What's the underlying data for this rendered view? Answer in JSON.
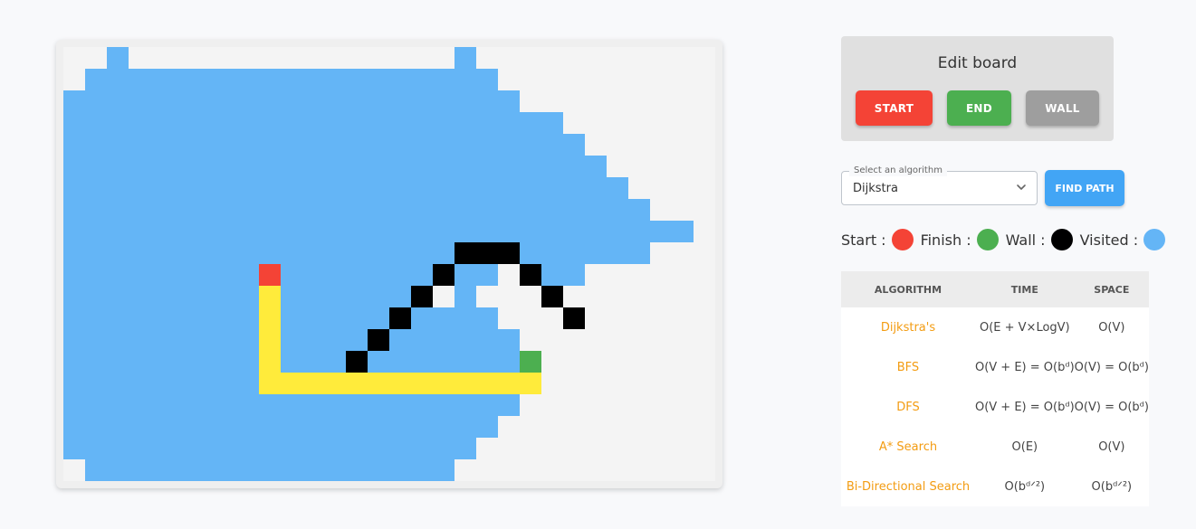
{
  "board": {
    "cols": 30,
    "rows": 20,
    "colors": {
      "empty": "#f4f4f4",
      "visited": "#64b5f6",
      "wall": "#000000",
      "path": "#ffeb3b",
      "start": "#f44336",
      "end": "#4caf50"
    },
    "cells": [
      "..V...............V...........",
      ".VVVVVVVVVVVVVVVVVVV..........",
      "VVVVVVVVVVVVVVVVVVVVV.........",
      "VVVVVVVVVVVVVVVVVVVVVVV.......",
      "VVVVVVVVVVVVVVVVVVVVVVVV......",
      "VVVVVVVVVVVVVVVVVVVVVVVVV.....",
      "VVVVVVVVVVVVVVVVVVVVVVVVVV....",
      "VVVVVVVVVVVVVVVVVVVVVVVVVVV...",
      "VVVVVVVVVVVVVVVVVVVVVVVVVVVVV.",
      "VVVVVVVVVVVVVVVVVVWWWVVVVVV...",
      "VVVVVVVVVSVVVVVVVWVV.WVV......",
      "VVVVVVVVVPVVVVVVW.V...W.......",
      "VVVVVVVVVPVVVVVWVVVV...W......",
      "VVVVVVVVVPVVVVWVVVVVV.........",
      "VVVVVVVVVPVVVWVVVVVVVE........",
      "VVVVVVVVVPPPPPPPPPPPPP........",
      "VVVVVVVVVVVVVVVVVVVVV.........",
      "VVVVVVVVVVVVVVVVVVVV..........",
      "VVVVVVVVVVVVVVVVVVV...........",
      ".VVVVVVVVVVVVVVVVV............"
    ]
  },
  "edit_board": {
    "title": "Edit board",
    "start_label": "START",
    "end_label": "END",
    "wall_label": "WALL"
  },
  "algorithm_select": {
    "label": "Select an algorithm",
    "value": "Dijkstra"
  },
  "find_path_label": "FIND PATH",
  "legend": {
    "start_label": "Start :",
    "finish_label": "Finish :",
    "wall_label": "Wall :",
    "visited_label": "Visited :",
    "start_color": "#f44336",
    "finish_color": "#4caf50",
    "wall_color": "#000000",
    "visited_color": "#64b5f6"
  },
  "table": {
    "headers": [
      "ALGORITHM",
      "TIME",
      "SPACE"
    ],
    "rows": [
      {
        "algorithm": "Dijkstra's",
        "time": "O(E + V×LogV)",
        "space": "O(V)"
      },
      {
        "algorithm": "BFS",
        "time": "O(V + E) = O(bᵈ)",
        "space": "O(V) = O(bᵈ)"
      },
      {
        "algorithm": "DFS",
        "time": "O(V + E) = O(bᵈ)",
        "space": "O(V) = O(bᵈ)"
      },
      {
        "algorithm": "A* Search",
        "time": "O(E)",
        "space": "O(V)"
      },
      {
        "algorithm": "Bi-Directional Search",
        "time": "O(bᵈᐟ²)",
        "space": "O(bᵈᐟ²)"
      }
    ]
  }
}
